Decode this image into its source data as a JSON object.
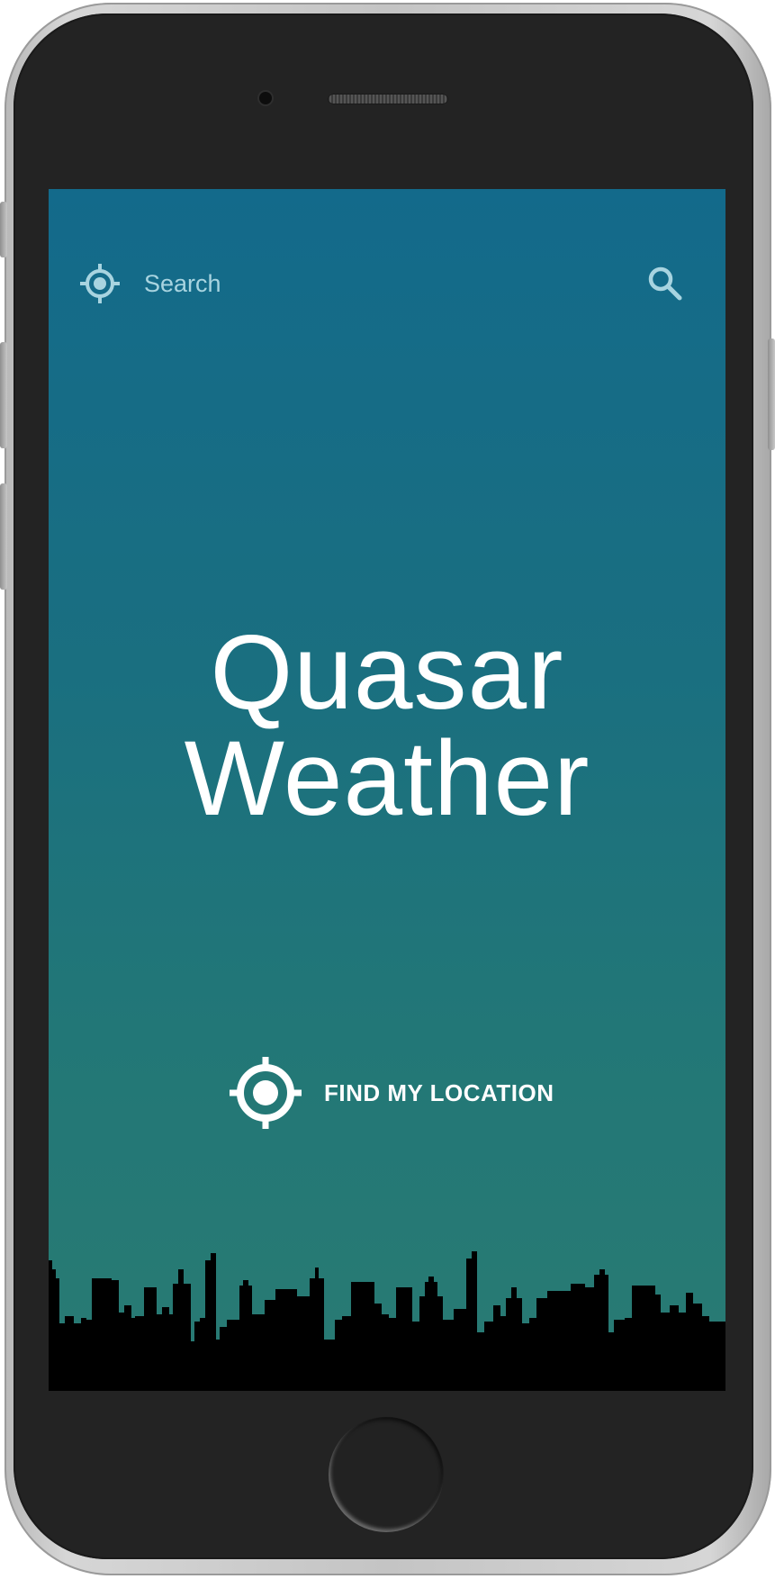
{
  "app": {
    "title_line1": "Quasar",
    "title_line2": "Weather"
  },
  "topbar": {
    "search_label": "Search",
    "left_icon": "location-crosshair-icon",
    "right_icon": "search-icon"
  },
  "action": {
    "find_location_label": "FIND MY LOCATION",
    "icon": "location-crosshair-icon"
  },
  "colors": {
    "gradient_top": "#136a8b",
    "gradient_bottom": "#297b73",
    "search_text": "#a8d4e0",
    "title_text": "#ffffff",
    "skyline": "#000000",
    "phone_body": "#232323"
  }
}
